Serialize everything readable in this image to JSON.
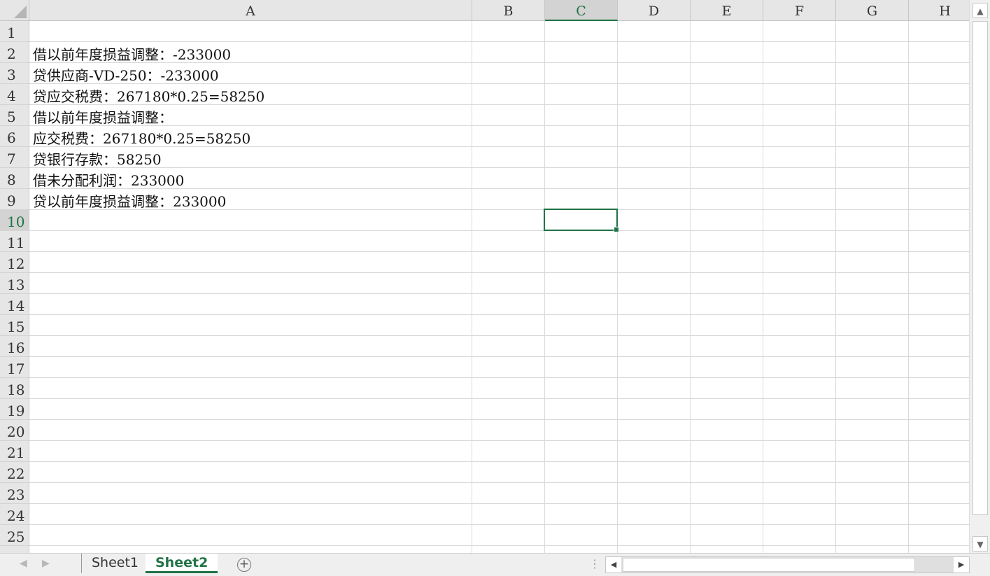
{
  "sheet": {
    "columns": [
      "A",
      "B",
      "C",
      "D",
      "E",
      "F",
      "G",
      "H"
    ],
    "selected_column": "C",
    "rows": [
      "1",
      "2",
      "3",
      "4",
      "5",
      "6",
      "7",
      "8",
      "9",
      "10",
      "11",
      "12",
      "13",
      "14",
      "15",
      "16",
      "17",
      "18",
      "19",
      "20",
      "21",
      "22",
      "23",
      "24",
      "25"
    ],
    "selected_row": "10",
    "cells_col_a": [
      "",
      "借以前年度损益调整：-233000",
      "贷供应商-VD-250：-233000",
      "贷应交税费：267180*0.25=58250",
      "借以前年度损益调整：",
      "应交税费：267180*0.25=58250",
      "贷银行存款：58250",
      "借未分配利润：233000",
      "贷以前年度损益调整：233000"
    ],
    "active_cell": "C10"
  },
  "tabs": {
    "sheet1": "Sheet1",
    "sheet2": "Sheet2",
    "active": "Sheet2"
  },
  "icons": {
    "add_sheet": "plus-circle-icon",
    "scroll_up": "triangle-up-icon",
    "scroll_down": "triangle-down-icon",
    "scroll_left": "triangle-left-icon",
    "scroll_right": "triangle-right-icon"
  },
  "colors": {
    "accent": "#217346"
  }
}
